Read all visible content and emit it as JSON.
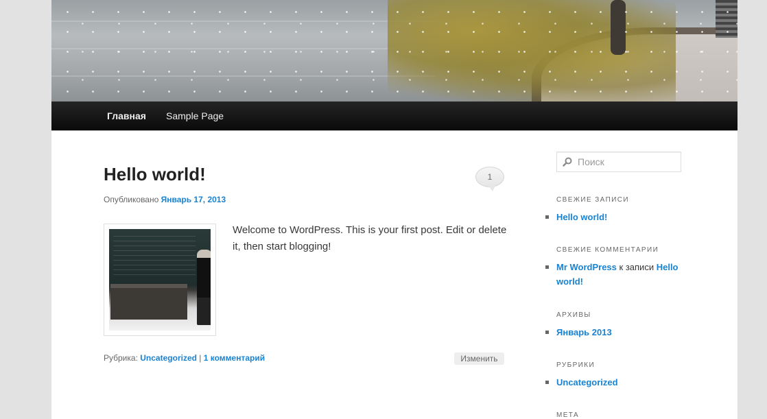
{
  "nav": {
    "items": [
      {
        "label": "Главная",
        "active": true
      },
      {
        "label": "Sample Page",
        "active": false
      }
    ]
  },
  "post": {
    "title": "Hello world!",
    "comment_count": "1",
    "meta_prefix": "Опубликовано",
    "date": "Январь 17, 2013",
    "content": "Welcome to WordPress. This is your first post. Edit or delete it, then start blogging!",
    "footer": {
      "category_label": "Рубрика:",
      "category": "Uncategorized",
      "separator": "|",
      "comments_link": "1 комментарий",
      "edit_label": "Изменить"
    }
  },
  "sidebar": {
    "search_placeholder": "Поиск",
    "widgets": {
      "recent_posts": {
        "title": "СВЕЖИЕ ЗАПИСИ",
        "item": "Hello world!"
      },
      "recent_comments": {
        "title": "СВЕЖИЕ КОММЕНТАРИИ",
        "author": "Mr WordPress",
        "middle": "к записи",
        "post_line1": "Hello",
        "post_line2": "world!"
      },
      "archives": {
        "title": "АРХИВЫ",
        "item": "Январь 2013"
      },
      "categories": {
        "title": "РУБРИКИ",
        "item": "Uncategorized"
      },
      "meta": {
        "title": "МЕТА"
      }
    }
  },
  "colors": {
    "link": "#1982d1",
    "nav_background": "#0a0a0a",
    "page_background": "#e2e2e2"
  }
}
